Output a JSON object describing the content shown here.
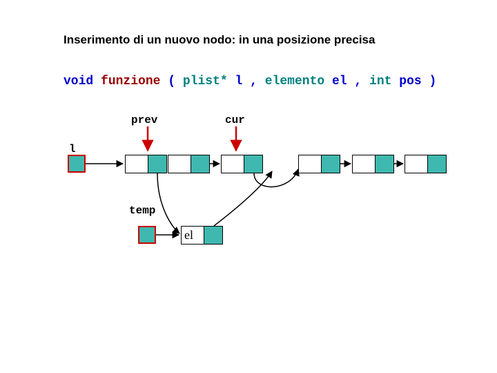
{
  "title": "Inserimento di un nuovo nodo: in una posizione precisa",
  "signature": {
    "kw_void": "void",
    "fn": "funzione",
    "open": "(",
    "t_plist": "plist*",
    "p_l": " l",
    "c1": ",",
    "t_elem": "elemento",
    "p_el": " el",
    "c2": ",",
    "t_int": "int",
    "p_pos": " pos",
    "close": ")"
  },
  "labels": {
    "prev": "prev",
    "cur": "cur",
    "l": "l",
    "temp": "temp",
    "el": "el"
  }
}
